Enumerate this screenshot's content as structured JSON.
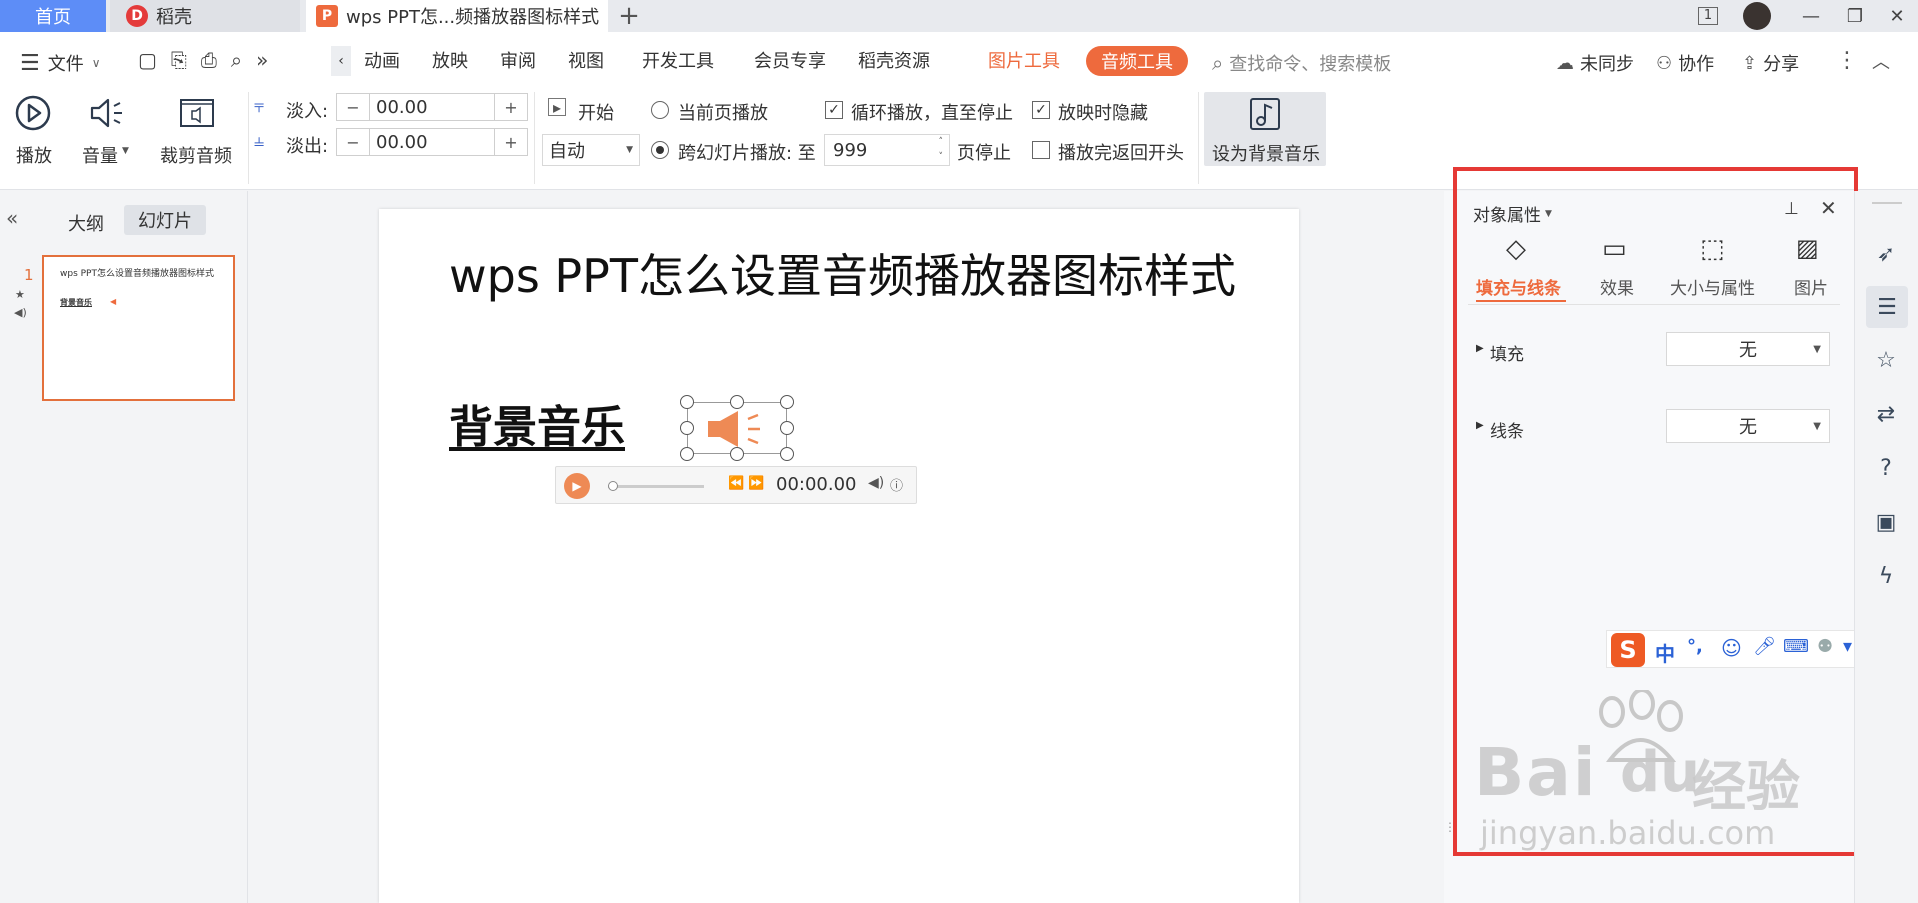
{
  "tabs": {
    "home": "首页",
    "daoke": "稻壳",
    "doc": "wps PPT怎...频播放器图标样式",
    "add": "+"
  },
  "window": {
    "page_count": "1",
    "minimize": "—",
    "restore": "❐",
    "close": "✕"
  },
  "menu": {
    "file": "文件",
    "items": [
      "动画",
      "放映",
      "审阅",
      "视图",
      "开发工具",
      "会员专享",
      "稻壳资源"
    ],
    "picture_tools": "图片工具",
    "audio_tools": "音频工具",
    "search_placeholder": "查找命令、搜索模板",
    "unsynced": "未同步",
    "collaborate": "协作",
    "share": "分享"
  },
  "ribbon": {
    "play": "播放",
    "volume": "音量",
    "trim": "裁剪音频",
    "fade_in_label": "淡入:",
    "fade_in_value": "00.00",
    "fade_out_label": "淡出:",
    "fade_out_value": "00.00",
    "start_label": "开始",
    "start_mode": "自动",
    "play_current": "当前页播放",
    "play_across": "跨幻灯片播放: 至",
    "page_value": "999",
    "page_stop": "页停止",
    "loop": "循环播放，直至停止",
    "hide_on_show": "放映时隐藏",
    "rewind": "播放完返回开头",
    "set_bg_music": "设为背景音乐",
    "loop_checked": true,
    "hide_checked": true,
    "rewind_checked": false
  },
  "left_panel": {
    "outline_tab": "大纲",
    "slides_tab": "幻灯片",
    "slide_number": "1",
    "thumb_title": "wps PPT怎么设置音频播放器图标样式",
    "thumb_sub": "背景音乐"
  },
  "slide": {
    "title": "wps PPT怎么设置音频播放器图标样式",
    "subtitle": "背景音乐",
    "time": "00:00.00"
  },
  "properties": {
    "header": "对象属性",
    "tabs": [
      "填充与线条",
      "效果",
      "大小与属性",
      "图片"
    ],
    "fill_label": "填充",
    "fill_value": "无",
    "line_label": "线条",
    "line_value": "无"
  },
  "ime": {
    "lang": "中",
    "punct": "°,"
  },
  "watermark": {
    "brand": "Bai",
    "brand2": "du",
    "cn": "经验",
    "url": "jingyan.baidu.com"
  },
  "colors": {
    "accent": "#ee6a3d",
    "highlight": "#e53935",
    "tab_blue": "#5d8df7"
  }
}
